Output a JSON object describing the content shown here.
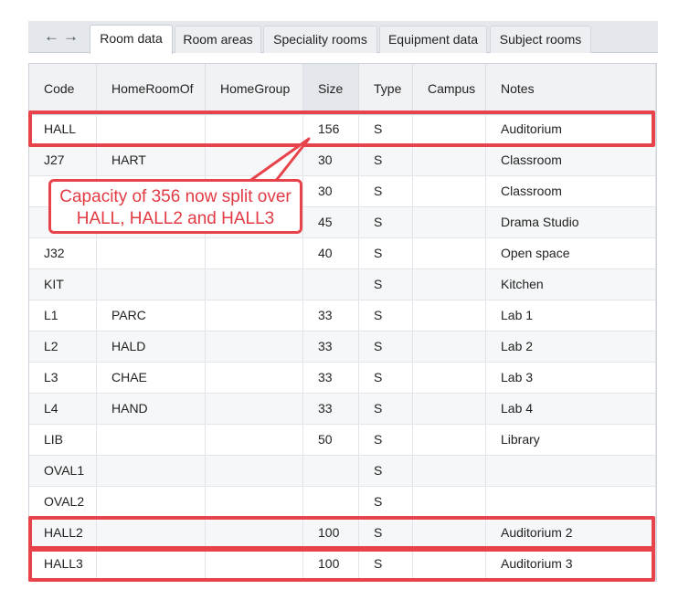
{
  "nav": {
    "back_icon": "←",
    "forward_icon": "→"
  },
  "tabs": [
    {
      "label": "Room data",
      "active": true
    },
    {
      "label": "Room areas",
      "active": false
    },
    {
      "label": "Speciality rooms",
      "active": false
    },
    {
      "label": "Equipment data",
      "active": false
    },
    {
      "label": "Subject rooms",
      "active": false
    }
  ],
  "table": {
    "headers": [
      "Code",
      "HomeRoomOf",
      "HomeGroup",
      "Size",
      "Type",
      "Campus",
      "Notes"
    ],
    "sorted_column": "Size",
    "rows": [
      [
        "HALL",
        "",
        "",
        "156",
        "S",
        "",
        "Auditorium"
      ],
      [
        "J27",
        "HART",
        "",
        "30",
        "S",
        "",
        "Classroom"
      ],
      [
        "",
        "",
        "",
        "30",
        "S",
        "",
        "Classroom"
      ],
      [
        "",
        "",
        "",
        "45",
        "S",
        "",
        "Drama Studio"
      ],
      [
        "J32",
        "",
        "",
        "40",
        "S",
        "",
        "Open space"
      ],
      [
        "KIT",
        "",
        "",
        "",
        "S",
        "",
        "Kitchen"
      ],
      [
        "L1",
        "PARC",
        "",
        "33",
        "S",
        "",
        "Lab 1"
      ],
      [
        "L2",
        "HALD",
        "",
        "33",
        "S",
        "",
        "Lab 2"
      ],
      [
        "L3",
        "CHAE",
        "",
        "33",
        "S",
        "",
        "Lab 3"
      ],
      [
        "L4",
        "HAND",
        "",
        "33",
        "S",
        "",
        "Lab 4"
      ],
      [
        "LIB",
        "",
        "",
        "50",
        "S",
        "",
        "Library"
      ],
      [
        "OVAL1",
        "",
        "",
        "",
        "S",
        "",
        ""
      ],
      [
        "OVAL2",
        "",
        "",
        "",
        "S",
        "",
        ""
      ],
      [
        "HALL2",
        "",
        "",
        "100",
        "S",
        "",
        "Auditorium 2"
      ],
      [
        "HALL3",
        "",
        "",
        "100",
        "S",
        "",
        "Auditorium 3"
      ]
    ]
  },
  "annotation": {
    "line1": "Capacity of 356 now split over",
    "line2": "HALL, HALL2 and HALL3"
  },
  "colors": {
    "highlight": "#e8434b",
    "annotation_text": "#e23b44"
  }
}
